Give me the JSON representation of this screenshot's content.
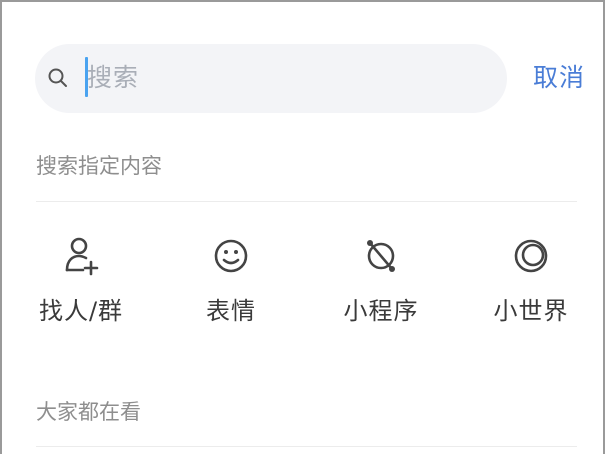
{
  "search": {
    "placeholder": "搜索",
    "cancel_label": "取消"
  },
  "sections": {
    "specific_title": "搜索指定内容",
    "trending_title": "大家都在看"
  },
  "quick_items": [
    {
      "label": "找人/群",
      "icon": "add-person-icon"
    },
    {
      "label": "表情",
      "icon": "smiley-icon"
    },
    {
      "label": "小程序",
      "icon": "planet-icon"
    },
    {
      "label": "小世界",
      "icon": "globe-circle-icon"
    }
  ],
  "colors": {
    "accent": "#4a7dd6",
    "caret": "#4aa3f0",
    "search_bg": "#f3f4f7"
  }
}
